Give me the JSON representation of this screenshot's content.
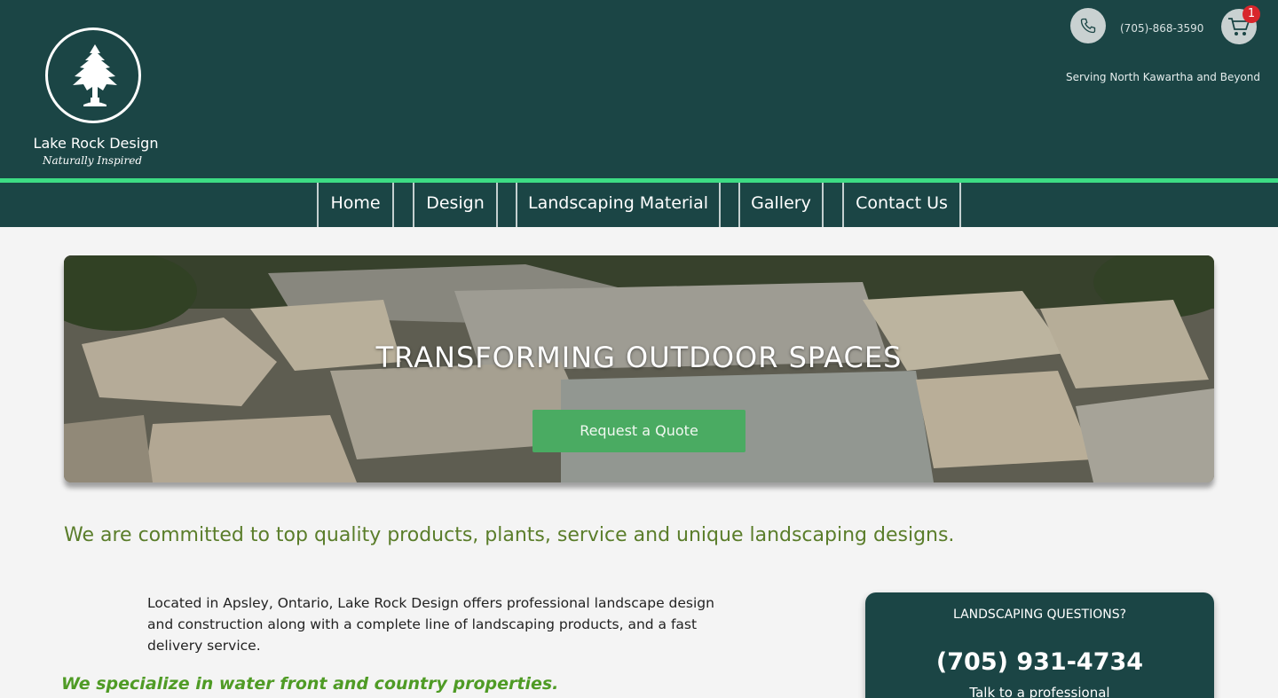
{
  "header": {
    "brand_name": "Lake Rock Design",
    "brand_tagline": "Naturally Inspired",
    "phone": "(705)-868-3590",
    "cart_count": "1",
    "serving": "Serving North Kawartha and Beyond"
  },
  "nav": {
    "items": [
      {
        "label": "Home"
      },
      {
        "label": "Design"
      },
      {
        "label": "Landscaping Material"
      },
      {
        "label": "Gallery"
      },
      {
        "label": "Contact Us"
      }
    ]
  },
  "hero": {
    "title": "TRANSFORMING OUTDOOR SPACES",
    "button_label": "Request a Quote"
  },
  "content": {
    "commitment": "We are committed to top quality products, plants, service and unique landscaping designs.",
    "intro": "Located in Apsley, Ontario, Lake Rock Design offers professional landscape design and construction along with a complete line of landscaping products, and a fast delivery service.",
    "specialize": "We specialize in water front and country properties."
  },
  "questions_box": {
    "title": "LANDSCAPING QUESTIONS?",
    "phone": "(705) 931-4734",
    "subtitle": "Talk to a professional"
  },
  "colors": {
    "header_bg": "#1b4545",
    "accent": "#3ddc84",
    "button": "#4aab62",
    "commit_text": "#5a7d2a"
  }
}
